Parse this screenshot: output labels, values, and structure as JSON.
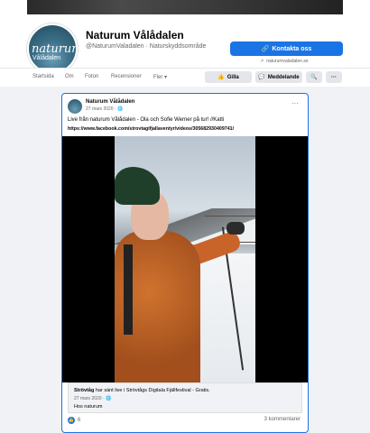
{
  "page": {
    "name": "Naturum Vålådalen",
    "handle": "@NaturumValadalen · Naturskyddsområde",
    "logo_main": "naturum",
    "logo_sub": "Vålådalen",
    "contact_button": "Kontakta oss",
    "website": "naturumvaladalen.se"
  },
  "nav": {
    "items": [
      "Startsida",
      "Om",
      "Foton",
      "Recensioner",
      "Fler"
    ],
    "like_button": "Gilla",
    "message_button": "Meddelande"
  },
  "post": {
    "author": "Naturum Vålådalen",
    "date": "27 mars 2020 · ",
    "text": "Live från naturum Vålådalen - Ola och Sofie Werner på tur! //Katti",
    "link": "https://www.facebook.com/strovtagifjallaventyr/videos/305682930409741/",
    "preview": {
      "title_bold": "Strövtåg",
      "title_rest": " har sänt live i Strövtågs Digitala Fjällfestival - Gratis.",
      "date": "27 mars 2020 · ",
      "subtitle": "Hos naturum"
    },
    "likes": "6",
    "comments": "3 kommentarer"
  }
}
